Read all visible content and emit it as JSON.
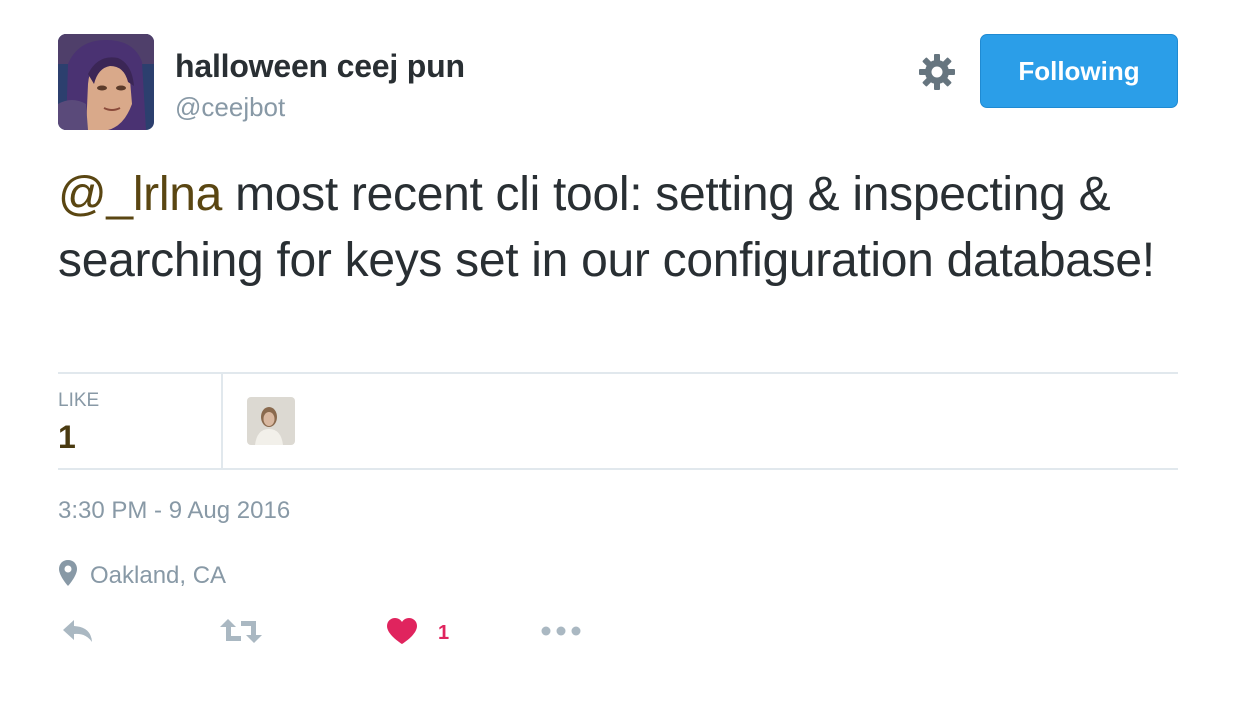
{
  "author": {
    "name": "halloween ceej pun",
    "handle": "@ceejbot"
  },
  "follow_button": {
    "label": "Following"
  },
  "tweet": {
    "mention": "@_lrlna",
    "text": " most recent cli tool: setting & inspecting & searching for keys set in our configuration database!"
  },
  "stats": {
    "like_label": "LIKE",
    "like_count": "1"
  },
  "timestamp": "3:30 PM - 9 Aug 2016",
  "location": "Oakland, CA",
  "actions": {
    "like_count": "1"
  },
  "icons": [
    "gear-icon",
    "location-pin-icon",
    "reply-icon",
    "retweet-icon",
    "heart-icon",
    "more-icon"
  ],
  "colors": {
    "accent": "#2b9ee8",
    "like": "#e0245e",
    "mention": "#5a4612",
    "muted": "#8899a6"
  }
}
